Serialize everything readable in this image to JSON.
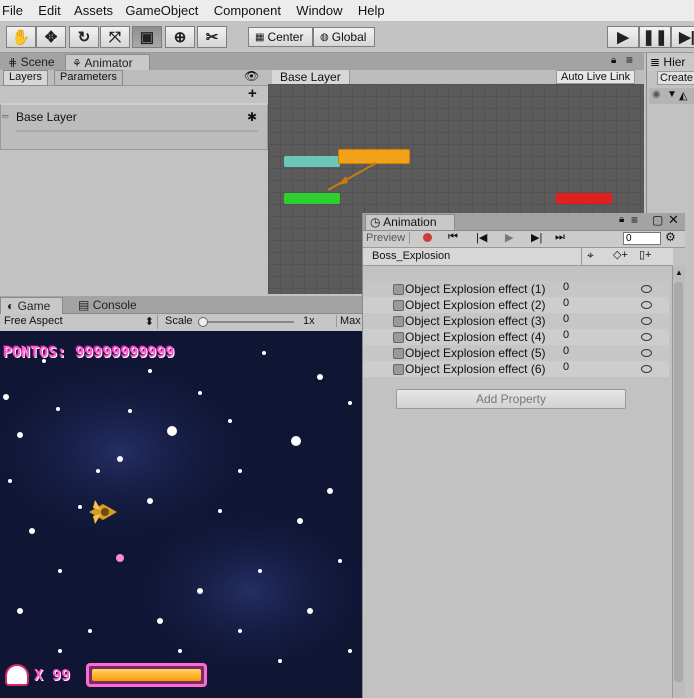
{
  "menu": [
    "File",
    "Edit",
    "Assets",
    "GameObject",
    "Component",
    "Window",
    "Help"
  ],
  "toolbar": {
    "center_label": "Center",
    "global_label": "Global"
  },
  "scene_tabs": {
    "scene": "Scene",
    "animator": "Animator",
    "hierarchy": "Hier"
  },
  "hierarchy": {
    "create_label": "Create"
  },
  "animator": {
    "layers_tab": "Layers",
    "parameters_tab": "Parameters",
    "plus": "+",
    "layer_name": "Base Layer",
    "breadcrumb": "Base Layer",
    "auto_live_link": "Auto Live Link"
  },
  "game_tabs": {
    "game": "Game",
    "console": "Console"
  },
  "game_toolbar": {
    "aspect": "Free Aspect",
    "scale_label": "Scale",
    "scale_value": "1x",
    "max_label": "Max"
  },
  "game": {
    "score": "PONTOS: 99999999999",
    "lives": "X 99",
    "health_fraction": 1.0
  },
  "animation": {
    "title": "Animation",
    "preview": "Preview",
    "frame_value": "0",
    "clip": "Boss_Explosion",
    "properties": [
      {
        "name": "Object Explosion effect (1)",
        "value": "0"
      },
      {
        "name": "Object Explosion effect (2)",
        "value": "0"
      },
      {
        "name": "Object Explosion effect (3)",
        "value": "0"
      },
      {
        "name": "Object Explosion effect (4)",
        "value": "0"
      },
      {
        "name": "Object Explosion effect (5)",
        "value": "0"
      },
      {
        "name": "Object Explosion effect (6)",
        "value": "0"
      }
    ],
    "add_property": "Add Property"
  },
  "colors": {
    "state_default": "#f2a11a",
    "state_entry": "#2fcf2f",
    "state_anystate": "#6cc6b9",
    "state_exit": "#e02020",
    "score_text": "#ff5ad6",
    "health_fill": "#ffa500"
  }
}
